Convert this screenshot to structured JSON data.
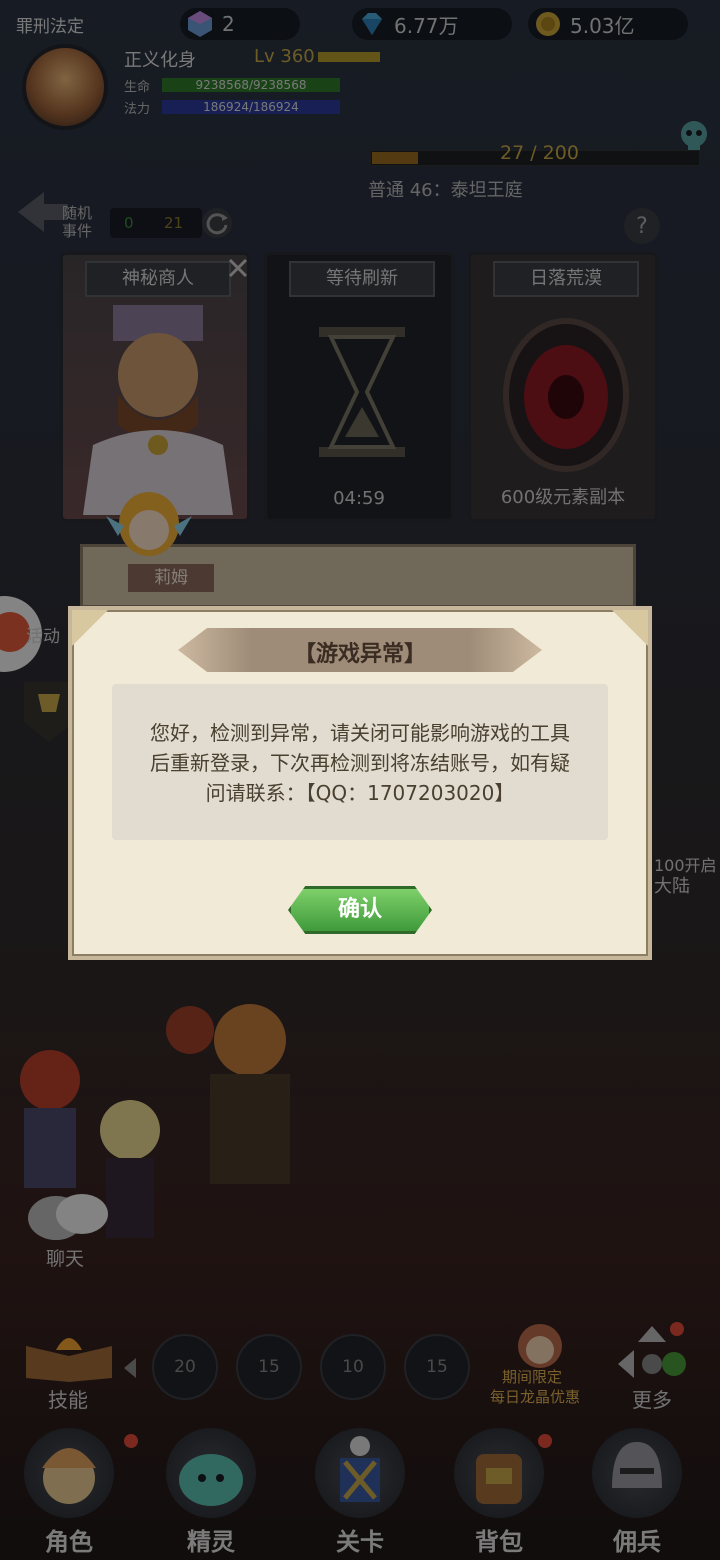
{
  "top_bar": {
    "player_title": "罪刑法定",
    "resources": [
      {
        "icon": "crystal-icon",
        "value": "2"
      },
      {
        "icon": "diamond-icon",
        "value": "6.77万"
      },
      {
        "icon": "gold-coin-icon",
        "value": "5.03亿"
      }
    ]
  },
  "player": {
    "name": "正义化身",
    "level": "Lv 360",
    "hp_label": "生命",
    "hp": "9238568/9238568",
    "mp_label": "法力",
    "mp": "186924/186924"
  },
  "stage": {
    "progress_text": "27 / 200",
    "progress": 0.135,
    "name": "普通 46：泰坦王庭"
  },
  "random_event": {
    "label_line1": "随机",
    "label_line2": "事件",
    "count_a": "0",
    "count_b": "21"
  },
  "cards": [
    {
      "title": "神秘商人",
      "footer": ""
    },
    {
      "title": "等待刷新",
      "footer": "04:59"
    },
    {
      "title": "日落荒漠",
      "footer": "600级元素副本"
    }
  ],
  "npc": {
    "name": "莉姆"
  },
  "side": {
    "activity": "活动",
    "continent": "100开启",
    "continent2": "大陆",
    "chat": "聊天"
  },
  "modal": {
    "title": "【游戏异常】",
    "message_line1": "您好，检测到异常，请关闭可能影响游戏的工具",
    "message_line2": "后重新登录，下次再检测到将冻结账号，如有疑",
    "message_line3": "问请联系：【QQ：1707203020】",
    "confirm_label": "确认"
  },
  "skills": {
    "label": "技能",
    "slots": [
      "20",
      "15",
      "10",
      "15"
    ]
  },
  "promo": {
    "line1": "期间限定",
    "line2": "每日龙晶优惠"
  },
  "more_label": "更多",
  "nav": [
    {
      "label": "角色",
      "icon": "hero-icon"
    },
    {
      "label": "精灵",
      "icon": "spirit-icon"
    },
    {
      "label": "关卡",
      "icon": "stage-icon"
    },
    {
      "label": "背包",
      "icon": "backpack-icon"
    },
    {
      "label": "佣兵",
      "icon": "mercenary-icon"
    }
  ],
  "colors": {
    "gold": "#c9a84a",
    "hp": "#2f7a2a",
    "mp": "#2a3a9a",
    "confirm": "#4fae44"
  }
}
